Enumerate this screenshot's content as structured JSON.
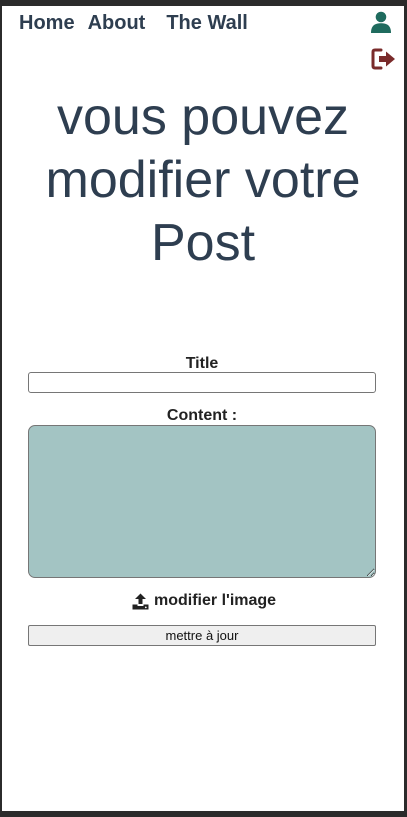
{
  "nav": {
    "items": [
      {
        "label": "Home"
      },
      {
        "label": "About"
      },
      {
        "label": "The Wall"
      }
    ]
  },
  "icons": {
    "profile": "user-icon",
    "logout": "sign-out-icon",
    "upload": "upload-icon"
  },
  "colors": {
    "heading": "#2e3e50",
    "user_icon": "#1f6b5e",
    "logout_icon": "#7a2b2b",
    "textarea_bg": "#a3c4c3"
  },
  "heading": {
    "line1": "vous pouvez",
    "line2": "modifier votre",
    "line3": "Post"
  },
  "form": {
    "title_label": "Title",
    "title_value": "",
    "content_label": "Content :",
    "content_value": "",
    "image_label": "modifier l'image",
    "submit_label": "mettre à jour"
  }
}
